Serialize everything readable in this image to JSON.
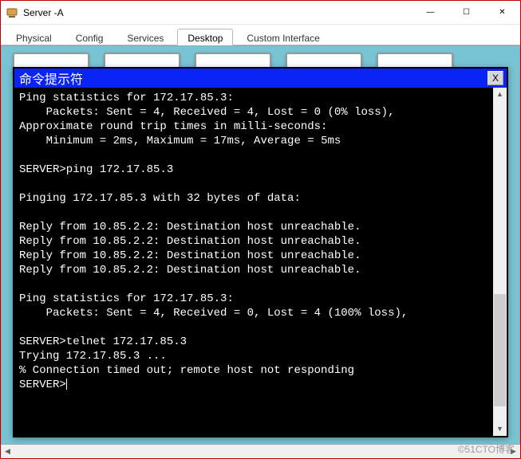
{
  "window": {
    "title": "Server -A",
    "buttons": {
      "min": "—",
      "max": "☐",
      "close": "✕"
    }
  },
  "tabs": {
    "items": [
      {
        "label": "Physical"
      },
      {
        "label": "Config"
      },
      {
        "label": "Services"
      },
      {
        "label": "Desktop"
      },
      {
        "label": "Custom Interface"
      }
    ],
    "active_index": 3
  },
  "prompt": {
    "title": "命令提示符",
    "close_label": "X"
  },
  "terminal": {
    "lines": [
      "Ping statistics for 172.17.85.3:",
      "    Packets: Sent = 4, Received = 4, Lost = 0 (0% loss),",
      "Approximate round trip times in milli-seconds:",
      "    Minimum = 2ms, Maximum = 17ms, Average = 5ms",
      "",
      "SERVER>ping 172.17.85.3",
      "",
      "Pinging 172.17.85.3 with 32 bytes of data:",
      "",
      "Reply from 10.85.2.2: Destination host unreachable.",
      "Reply from 10.85.2.2: Destination host unreachable.",
      "Reply from 10.85.2.2: Destination host unreachable.",
      "Reply from 10.85.2.2: Destination host unreachable.",
      "",
      "Ping statistics for 172.17.85.3:",
      "    Packets: Sent = 4, Received = 0, Lost = 4 (100% loss),",
      "",
      "SERVER>telnet 172.17.85.3",
      "Trying 172.17.85.3 ...",
      "% Connection timed out; remote host not responding",
      "SERVER>"
    ]
  },
  "watermark": "©51CTO博客"
}
